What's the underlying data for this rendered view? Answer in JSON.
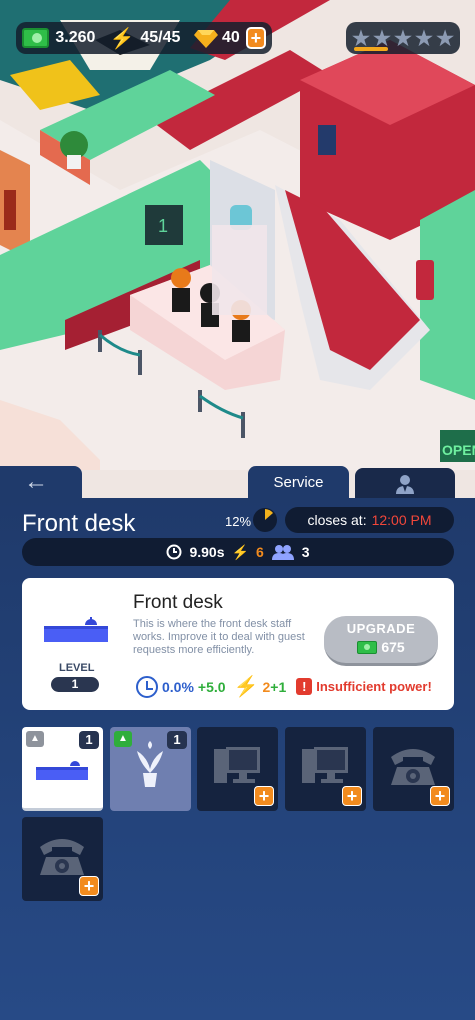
{
  "hud": {
    "cash": "3.260",
    "energy": "45/45",
    "gems": "40",
    "add_gems_label": "+",
    "stars": [
      "★",
      "★",
      "★",
      "★",
      "★"
    ],
    "star_progress": 0.3
  },
  "tabs": {
    "back": "←",
    "service": "Service",
    "staff_icon": "person-icon"
  },
  "header": {
    "title": "Front desk",
    "occupancy_pct": "12%",
    "closes_label": "closes at:",
    "closes_time": "12:00 PM"
  },
  "stats": {
    "time": "9.90s",
    "energy": "6",
    "guests": "3"
  },
  "card": {
    "title": "Front desk",
    "description": "This is where the front desk staff works. Improve it to deal with guest requests more efficiently.",
    "level_label": "LEVEL",
    "level": "1",
    "upgrade_label": "UPGRADE",
    "upgrade_cost": "675",
    "stat_speed": "0.0%",
    "stat_speed_gain": "+5.0",
    "stat_power": "2",
    "stat_power_gain": "+1",
    "warning": "Insufficient power!"
  },
  "slots": [
    {
      "item": "desk",
      "count": "1",
      "state": "active"
    },
    {
      "item": "plant",
      "count": "1",
      "state": "owned"
    },
    {
      "item": "computer",
      "state": "locked",
      "add": "+"
    },
    {
      "item": "computer",
      "state": "locked",
      "add": "+"
    },
    {
      "item": "telephone",
      "state": "locked",
      "add": "+"
    },
    {
      "item": "telephone",
      "state": "locked",
      "add": "+"
    }
  ],
  "colors": {
    "panel": "#1f3a6b",
    "accent_orange": "#f28b1e",
    "warning_red": "#e23b2e",
    "wall_green": "#5fd39a",
    "carpet_red": "#c2283d"
  }
}
